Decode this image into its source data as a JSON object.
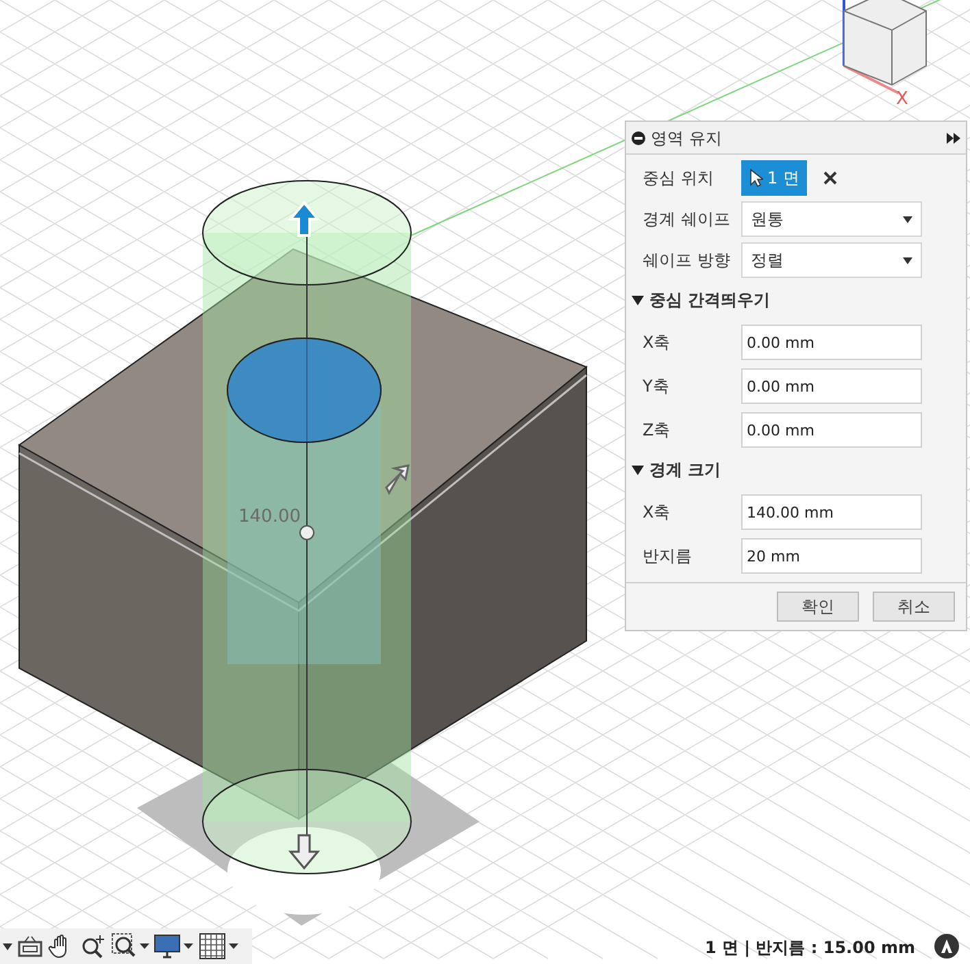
{
  "viewport": {
    "dimension_label": "140.00"
  },
  "view_cube": {
    "axis_label": "X"
  },
  "panel": {
    "title": "영역 유지",
    "rows": [
      {
        "kind": "select",
        "label": "중심 위치",
        "value": "1 면"
      },
      {
        "kind": "dropdown",
        "label": "경계 쉐이프",
        "value": "원통"
      },
      {
        "kind": "dropdown",
        "label": "쉐이프 방향",
        "value": "정렬"
      }
    ],
    "sections": [
      {
        "title": "중심 간격띄우기",
        "expanded": true,
        "fields": [
          {
            "label": "X축",
            "value": "0.00 mm"
          },
          {
            "label": "Y축",
            "value": "0.00 mm"
          },
          {
            "label": "Z축",
            "value": "0.00 mm"
          }
        ]
      },
      {
        "title": "경계 크기",
        "expanded": true,
        "fields": [
          {
            "label": "X축",
            "value": "140.00 mm"
          },
          {
            "label": "반지름",
            "value": "20 mm"
          }
        ]
      }
    ],
    "buttons": [
      "확인",
      "취소"
    ]
  },
  "status": "1 면 | 반지름 : 15.00 mm"
}
